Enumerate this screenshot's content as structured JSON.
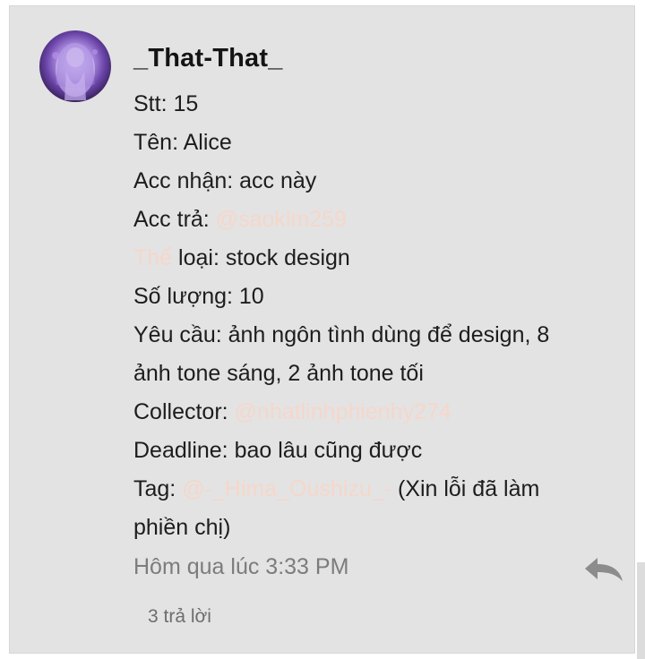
{
  "comment": {
    "author": "_That-That_",
    "lines": {
      "stt": "Stt: 15",
      "ten": "Tên: Alice",
      "acc_nhan": "Acc nhận: acc này",
      "acc_tra_label": "Acc trả: ",
      "acc_tra_mention": "@saoklm259",
      "the_loai_prefix": "Thể",
      "the_loai_rest": " loại: stock design",
      "so_luong": "Số lượng: 10",
      "yeu_cau_1": "Yêu cầu: ảnh ngôn tình dùng để design, 8",
      "yeu_cau_2": "ảnh tone sáng, 2 ảnh tone tối",
      "collector_label": "Collector: ",
      "collector_mention": "@nhatlinhphienhy274",
      "deadline": "Deadline: bao lâu cũng được",
      "tag_label": "Tag: ",
      "tag_mention": "@-_Hima_Oushizu_-",
      "tag_rest": " (Xin lỗi đã làm",
      "tag_rest_2": "phiền chị)"
    },
    "timestamp": "Hôm qua lúc 3:33 PM",
    "replies_count": "3 trả lời",
    "reply_icon": "reply-arrow-icon"
  },
  "colors": {
    "card_background": "#e3e3e3",
    "mention": "#f5d7cb",
    "text": "#1d1d1d",
    "muted": "#7c7c7c"
  }
}
